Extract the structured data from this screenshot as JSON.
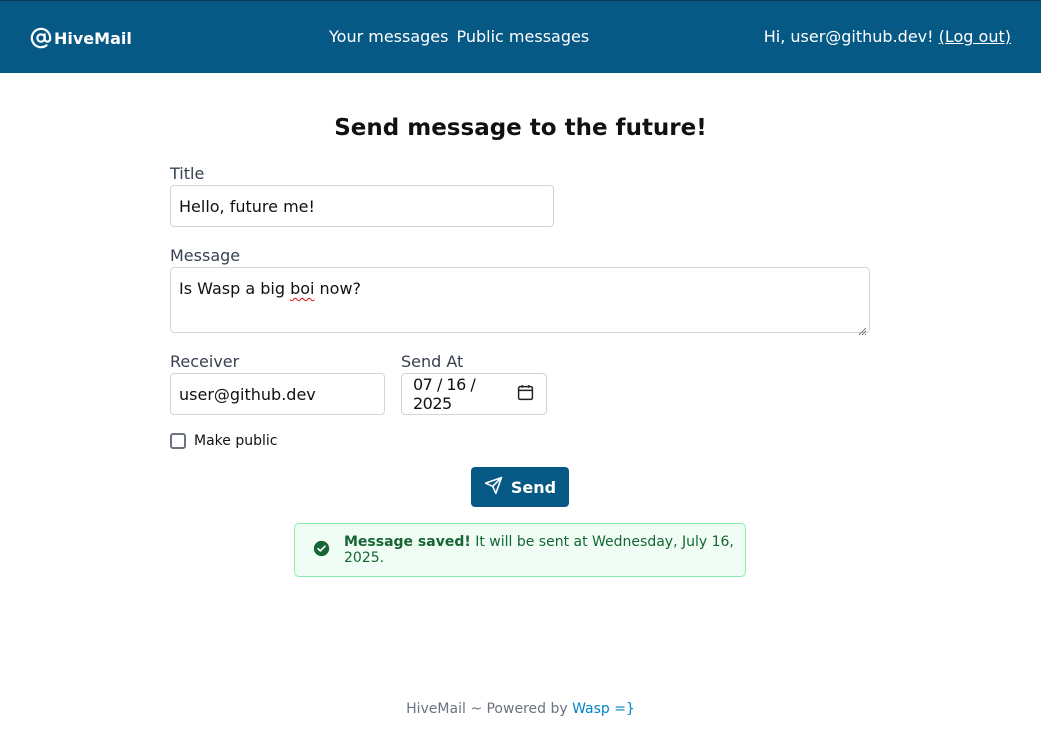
{
  "header": {
    "brand": "HiveMail",
    "nav": [
      "Your messages",
      "Public messages"
    ],
    "greeting": "Hi, user@github.dev!",
    "logout": "(Log out)"
  },
  "form": {
    "heading": "Send message to the future!",
    "title_label": "Title",
    "title_value": "Hello, future me!",
    "message_label": "Message",
    "message_before": "Is Wasp a big ",
    "message_misspelled": "boi",
    "message_after": " now?",
    "receiver_label": "Receiver",
    "receiver_value": "user@github.dev",
    "send_at_label": "Send At",
    "send_at_value": "07 / 16 / 2025",
    "make_public_label": "Make public",
    "make_public_checked": false,
    "send_label": "Send"
  },
  "alert": {
    "strong": "Message saved!",
    "text": " It will be sent at Wednesday, July 16, 2025."
  },
  "footer": {
    "text": "HiveMail ~ Powered by ",
    "link": "Wasp =}"
  },
  "colors": {
    "header_bg": "#075985",
    "button_bg": "#075985",
    "success_bg": "#f0fdf4",
    "success_text": "#166534",
    "link": "#0284c7"
  }
}
